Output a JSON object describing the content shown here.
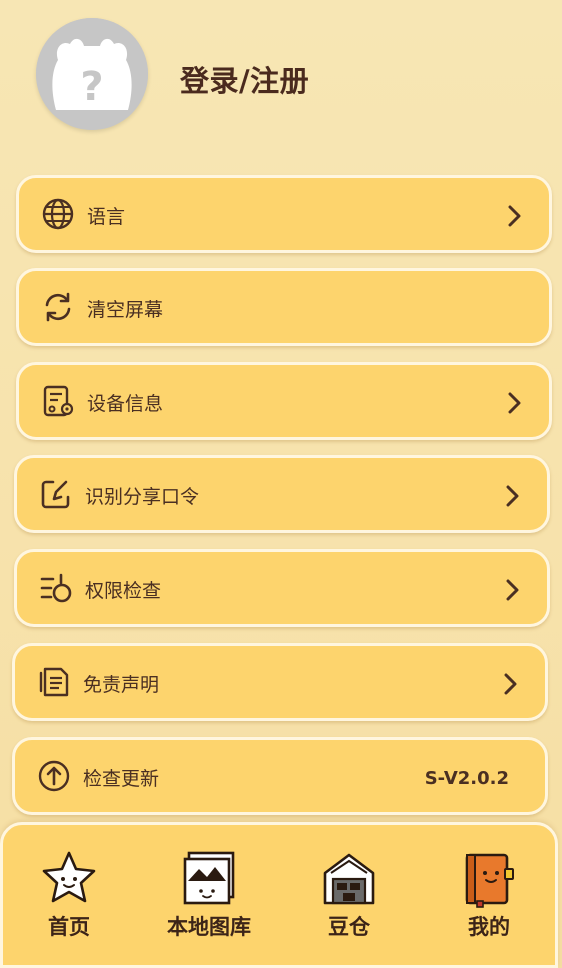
{
  "header": {
    "login_label": "登录/注册"
  },
  "menu": [
    {
      "label": "语言",
      "icon": "globe-icon",
      "chevron": true
    },
    {
      "label": "清空屏幕",
      "icon": "refresh-icon",
      "chevron": false
    },
    {
      "label": "设备信息",
      "icon": "device-info-icon",
      "chevron": true
    },
    {
      "label": "识别分享口令",
      "icon": "share-code-icon",
      "chevron": true
    },
    {
      "label": "权限检查",
      "icon": "permission-check-icon",
      "chevron": true
    },
    {
      "label": "免责声明",
      "icon": "document-icon",
      "chevron": true
    },
    {
      "label": "检查更新",
      "icon": "upload-arrow-icon",
      "value": "S-V2.0.2"
    }
  ],
  "nav": [
    {
      "label": "首页",
      "icon": "star-face-icon"
    },
    {
      "label": "本地图库",
      "icon": "photo-gallery-icon"
    },
    {
      "label": "豆仓",
      "icon": "warehouse-icon"
    },
    {
      "label": "我的",
      "icon": "notebook-icon"
    }
  ],
  "colors": {
    "background": "#f7e2ab",
    "card": "#fdd46d",
    "card_border": "#fff6df",
    "text": "#4a2f22"
  }
}
